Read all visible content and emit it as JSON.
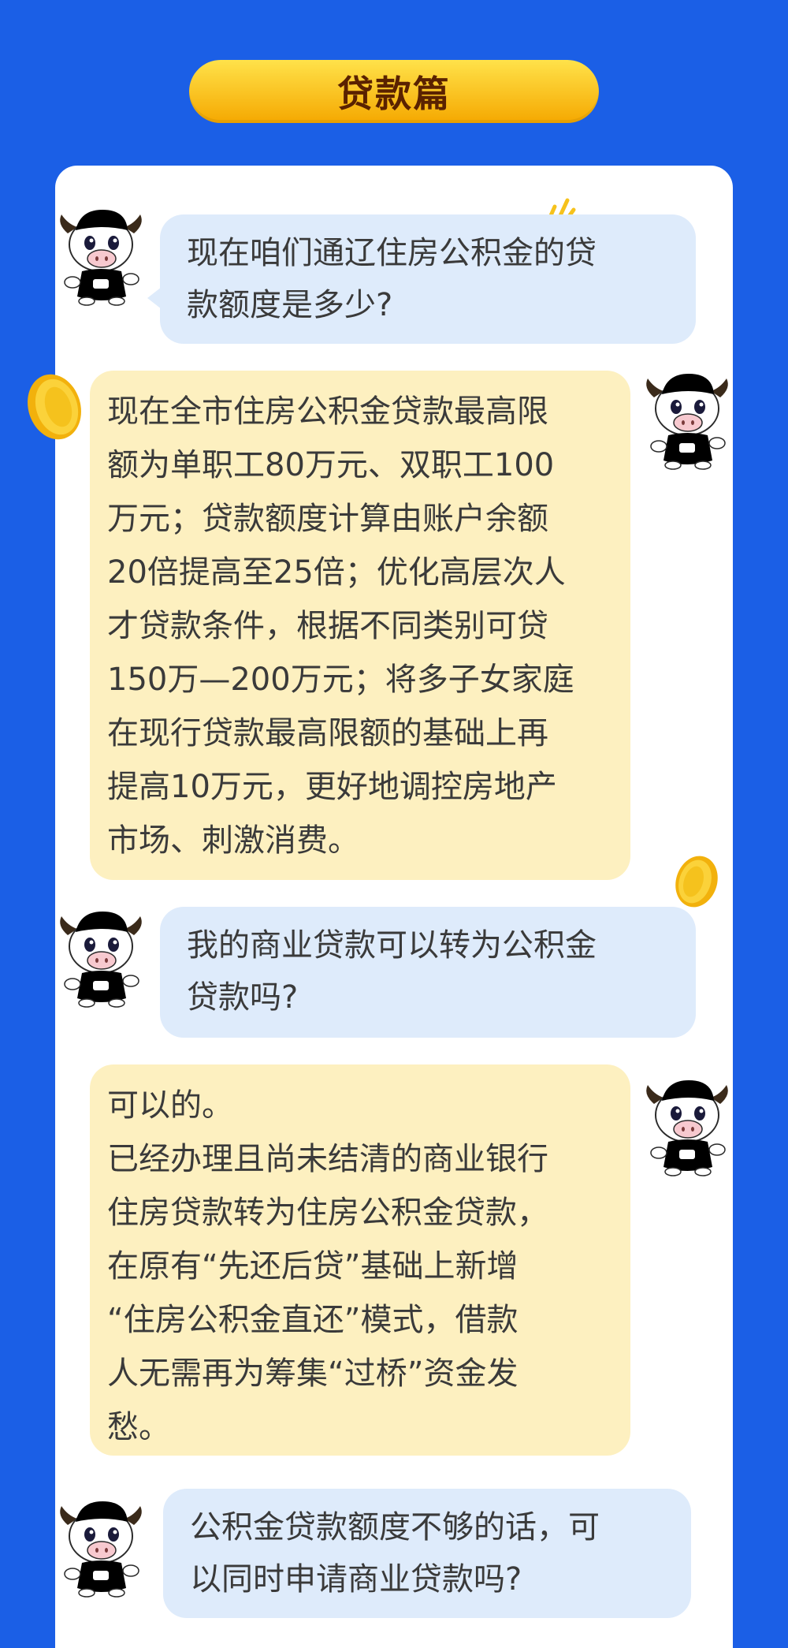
{
  "title": "贷款篇",
  "q1": {
    "lines": [
      "现在咱们通辽住房公积金的贷",
      "款额度是多少?"
    ]
  },
  "a1": {
    "lines": [
      "现在全市住房公积金贷款最高限",
      "额为单职工80万元、双职工100",
      "万元；贷款额度计算由账户余额",
      "20倍提高至25倍；优化高层次人",
      "才贷款条件，根据不同类别可贷",
      "150万—200万元；将多子女家庭",
      "在现行贷款最高限额的基础上再",
      "提高10万元，更好地调控房地产",
      "市场、刺激消费。"
    ]
  },
  "q2": {
    "lines": [
      "我的商业贷款可以转为公积金",
      "贷款吗?"
    ]
  },
  "a2": {
    "lines": [
      "可以的。",
      "已经办理且尚未结清的商业银行",
      "住房贷款转为住房公积金贷款，",
      "在原有“先还后贷”基础上新增",
      "“住房公积金直还”模式，借款",
      "人无需再为筹集“过桥”资金发",
      "愁。"
    ]
  },
  "q3": {
    "lines": [
      "公积金贷款额度不够的话，可",
      "以同时申请商业贷款吗?"
    ]
  },
  "icons": {
    "mascot_blue": "blue-cow-mascot",
    "mascot_orange": "orange-cow-mascot",
    "coin": "gold-coin",
    "sparkle": "sparkle-marks"
  },
  "colors": {
    "background": "#1b5fe6",
    "question_bubble": "#deebfb",
    "answer_bubble": "#fdf0c0",
    "title_pill": "#fbc21a"
  }
}
